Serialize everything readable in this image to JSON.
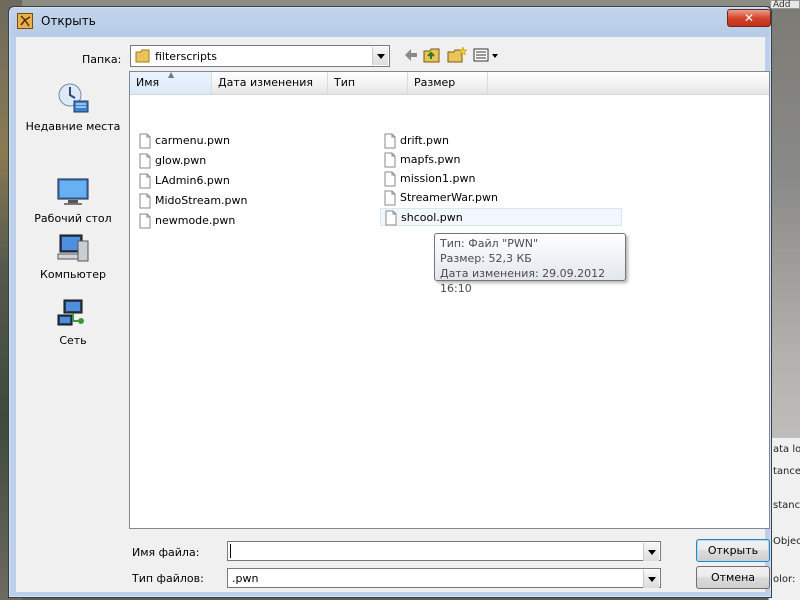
{
  "dialog": {
    "title": "Открыть",
    "close_label": "✕",
    "folder_label": "Папка:",
    "folder_value": "filterscripts",
    "places": [
      {
        "label": "Недавние места",
        "icon": "recent-places-icon"
      },
      {
        "label": "Рабочий стол",
        "icon": "desktop-icon"
      },
      {
        "label": "Компьютер",
        "icon": "computer-icon"
      },
      {
        "label": "Сеть",
        "icon": "network-icon"
      }
    ],
    "columns": {
      "name": "Имя",
      "date": "Дата изменения",
      "type": "Тип",
      "size": "Размер"
    },
    "files_col1": [
      "carmenu.pwn",
      "glow.pwn",
      "LAdmin6.pwn",
      "MidoStream.pwn",
      "newmode.pwn"
    ],
    "files_col2": [
      "drift.pwn",
      "mapfs.pwn",
      "mission1.pwn",
      "StreamerWar.pwn",
      "shcool.pwn"
    ],
    "tooltip": {
      "type": "Тип: Файл \"PWN\"",
      "size": "Размер: 52,3 КБ",
      "date": "Дата изменения: 29.09.2012 16:10"
    },
    "filename_label": "Имя файла:",
    "filename_value": "",
    "filetype_label": "Тип файлов:",
    "filetype_value": ".pwn",
    "open_button": "Открыть",
    "cancel_button": "Отмена"
  },
  "background": {
    "add_label": "Add",
    "side_items": [
      "ata lo",
      "tance",
      "stanc",
      "Objec",
      "olor:"
    ]
  }
}
